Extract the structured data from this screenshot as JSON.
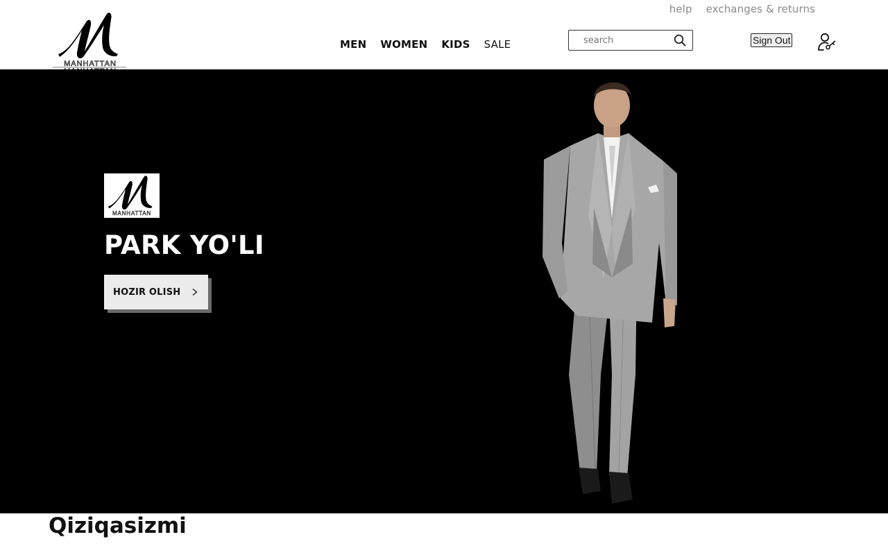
{
  "brand": {
    "name": "MANHATTAN"
  },
  "top_links": [
    {
      "label": "help"
    },
    {
      "label": "exchanges & returns"
    }
  ],
  "nav": [
    {
      "label": "MEN",
      "bold": true
    },
    {
      "label": "WOMEN",
      "bold": true
    },
    {
      "label": "KIDS",
      "bold": true
    },
    {
      "label": "SALE",
      "bold": false
    }
  ],
  "search": {
    "placeholder": "search",
    "icon": "search-icon"
  },
  "account": {
    "signout_label": "Sign Out",
    "icon": "user-key-icon"
  },
  "hero": {
    "title": "PARK YO'LI",
    "cta_label": "HOZIR OLISH",
    "cta_icon": "chevron-right-icon",
    "image": "man-in-grey-suit"
  },
  "section": {
    "heading": "Qiziqasizmi"
  },
  "colors": {
    "hero_background": "#000000",
    "cta_background": "#ececec",
    "top_link": "#8a8a8a"
  }
}
